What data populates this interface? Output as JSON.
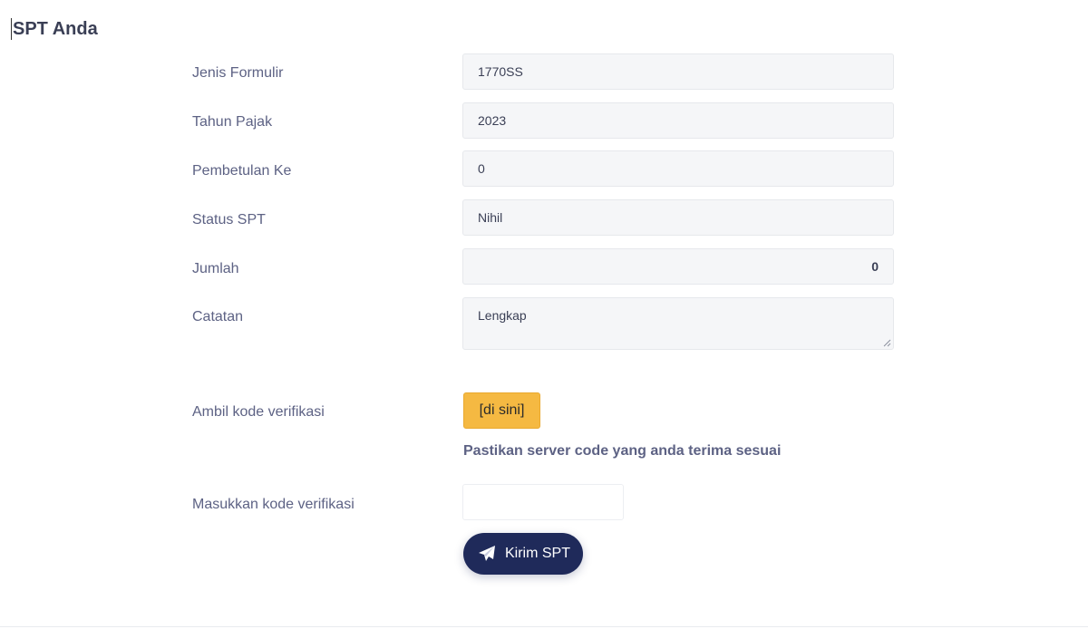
{
  "page": {
    "title": "SPT Anda"
  },
  "form": {
    "jenis_formulir": {
      "label": "Jenis Formulir",
      "value": "1770SS"
    },
    "tahun_pajak": {
      "label": "Tahun Pajak",
      "value": "2023"
    },
    "pembetulan_ke": {
      "label": "Pembetulan Ke",
      "value": "0"
    },
    "status_spt": {
      "label": "Status SPT",
      "value": "Nihil"
    },
    "jumlah": {
      "label": "Jumlah",
      "value": "0"
    },
    "catatan": {
      "label": "Catatan",
      "value": "Lengkap"
    }
  },
  "verification": {
    "get_label": "Ambil kode verifikasi",
    "get_button": "[di sini]",
    "hint": "Pastikan server code yang anda terima sesuai",
    "input_label": "Masukkan kode verifikasi",
    "input_value": ""
  },
  "submit": {
    "label": "Kirim SPT",
    "icon": "paper-plane-icon"
  },
  "colors": {
    "accent_button": "#f5b942",
    "primary_button": "#1f2a5a",
    "field_bg": "#f5f6f8",
    "label_text": "#5d6284"
  }
}
